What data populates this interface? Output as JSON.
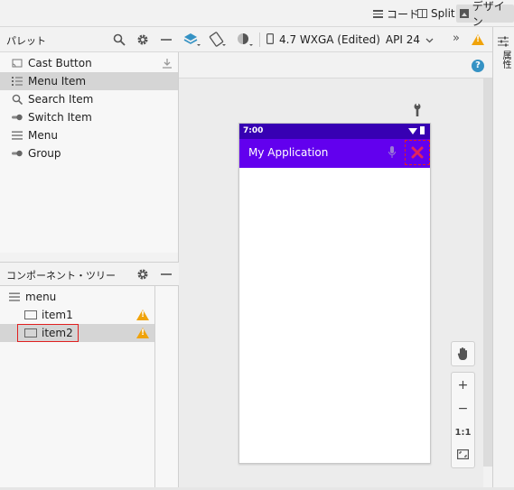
{
  "topbar": {
    "code_label": "コード",
    "split_label": "Split",
    "design_label": "デザイン"
  },
  "palette": {
    "title": "パレット",
    "items": [
      {
        "label": "Cast Button",
        "icon": "cast-icon"
      },
      {
        "label": "Menu Item",
        "icon": "menu-list-icon"
      },
      {
        "label": "Search Item",
        "icon": "search-icon"
      },
      {
        "label": "Switch Item",
        "icon": "switch-icon"
      },
      {
        "label": "Menu",
        "icon": "hamburger-icon"
      },
      {
        "label": "Group",
        "icon": "group-icon"
      }
    ],
    "selected": "Menu Item"
  },
  "component_tree": {
    "title": "コンポーネント・ツリー",
    "root": "menu",
    "items": [
      {
        "label": "item1",
        "warning": true
      },
      {
        "label": "item2",
        "warning": true,
        "selected": true
      }
    ]
  },
  "design_toolbar": {
    "device_label": "4.7  WXGA (Edited)",
    "api_label": "API 24",
    "overflow_label": "»"
  },
  "right_strip": {
    "label": "属性"
  },
  "preview": {
    "status_time": "7:00",
    "app_title": "My Application",
    "statusbar_color": "#3700b3",
    "appbar_color": "#6200ee",
    "close_color": "#e0245e"
  },
  "zoom": {
    "plus": "+",
    "minus": "−",
    "one_to_one": "1:1"
  },
  "colors": {
    "warning": "#f0a30a",
    "help": "#3592c4",
    "selection_outline": "#e02020"
  }
}
